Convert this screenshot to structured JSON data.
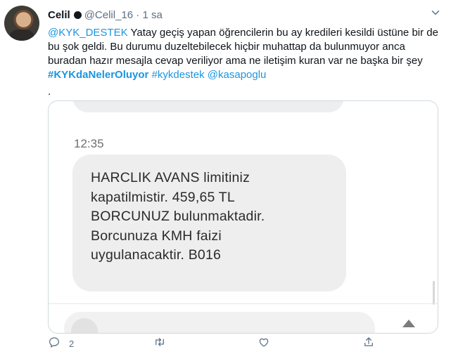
{
  "tweet": {
    "display_name": "Celil",
    "handle": "@Celil_16",
    "separator": "·",
    "time": "1 sa",
    "text_parts": {
      "mention": "@KYK_DESTEK",
      "body": " Yatay geçiş yapan öğrencilerin bu ay kredileri kesildi üstüne bir de bu şok geldi. Bu durumu duzeltebilecek hiçbir muhattap da bulunmuyor anca buradan hazır mesajla cevap veriliyor ama ne iletişim kuran var ne başka bir şey ",
      "hashtag_bold": "#KYKdaNelerOluyor",
      "hashtag": "#kykdestek",
      "mention2": "@kasapoglu",
      "trailing": "."
    }
  },
  "media": {
    "sms_time": "12:35",
    "message_lines": [
      "HARCLIK AVANS limitiniz",
      "kapatilmistir. 459,65 TL",
      "BORCUNUZ bulunmaktadir.",
      "Borcunuza KMH faizi",
      "uygulanacaktir. B016"
    ]
  },
  "actions": {
    "reply_count": "2",
    "icons": [
      "reply-icon",
      "retweet-icon",
      "like-icon",
      "share-icon"
    ]
  },
  "colors": {
    "link": "#1b95e0",
    "muted": "#5b7083",
    "bubble": "#eeeeee"
  }
}
